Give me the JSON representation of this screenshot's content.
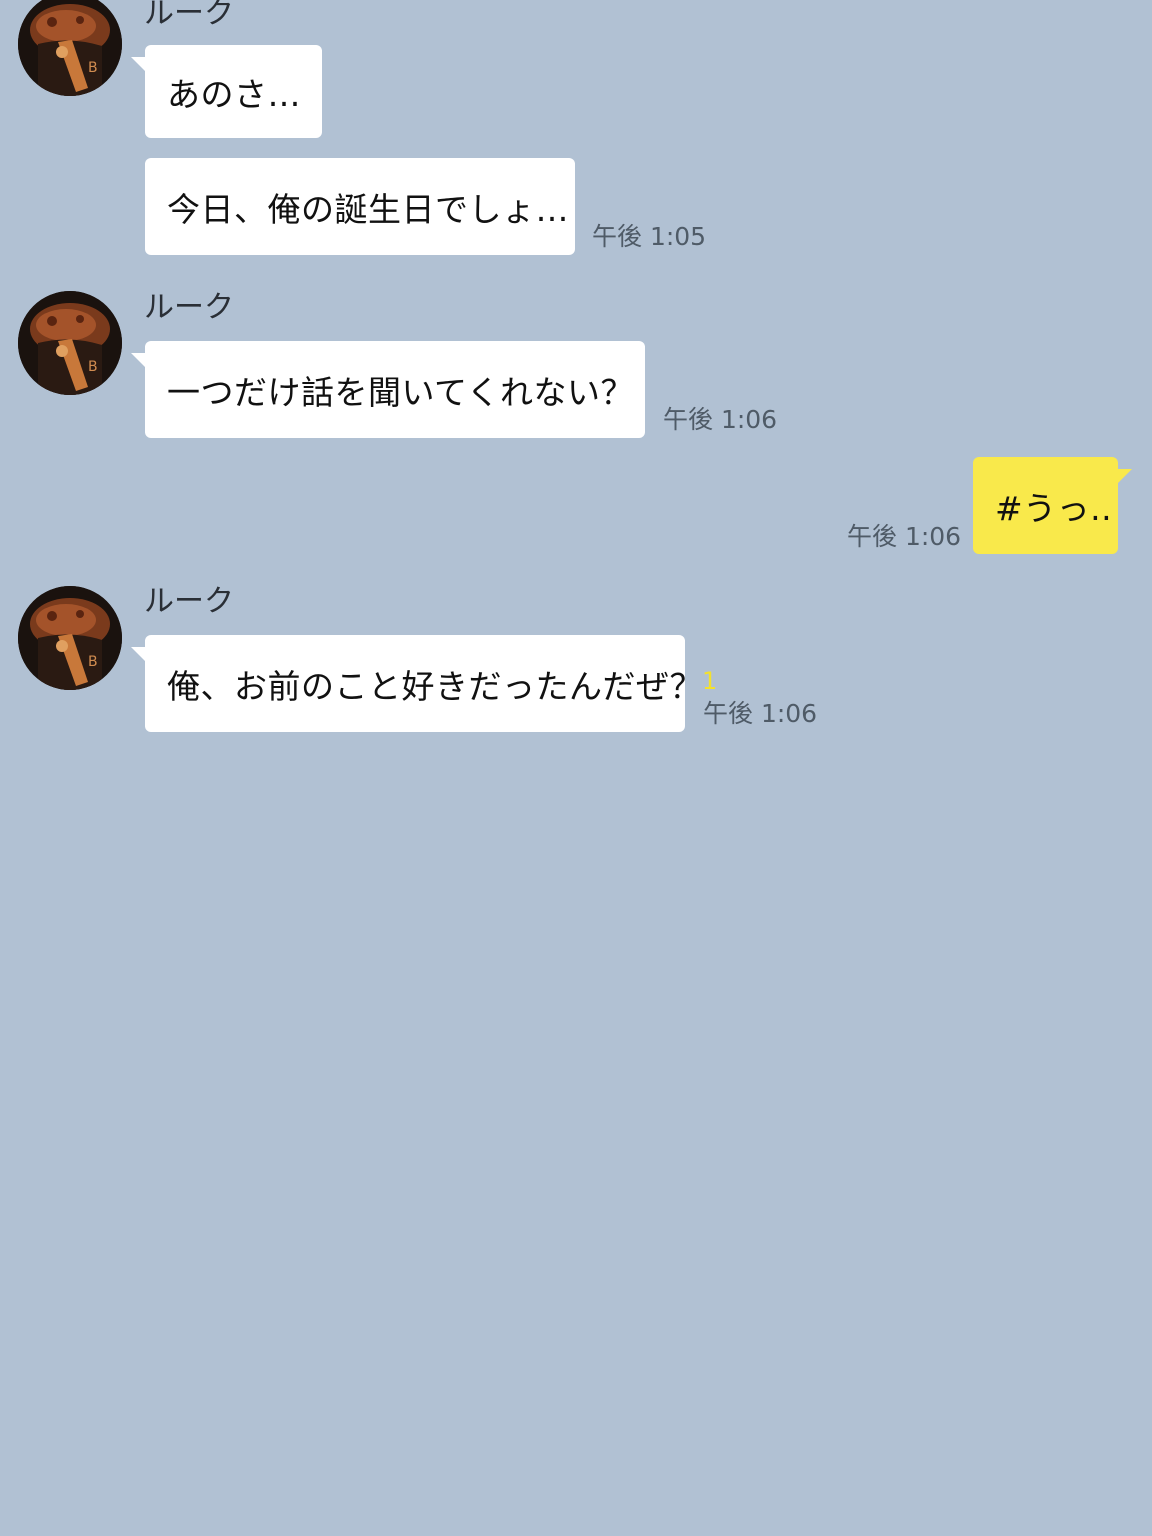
{
  "messages": [
    {
      "id": 1,
      "sender": "ルーク",
      "text": "あのさ…",
      "time": ""
    },
    {
      "id": 2,
      "sender": "",
      "text": "今日、俺の誕生日でしょ…",
      "time": "午後 1:05"
    },
    {
      "id": 3,
      "sender": "ルーク",
      "text": "一つだけ話を聞いてくれない？",
      "time": "午後 1:06"
    },
    {
      "id": 4,
      "sender": "me",
      "text": "#うっ..",
      "time": "午後 1:06"
    },
    {
      "id": 5,
      "sender": "ルーク",
      "text": "俺、お前のこと好きだったんだぜ？",
      "time": "午後 1:06",
      "read_count": "1"
    }
  ],
  "colors": {
    "background": "#b1c1d3",
    "incoming_bubble": "#ffffff",
    "outgoing_bubble": "#f9e94b",
    "read_count": "#f3e12e"
  }
}
